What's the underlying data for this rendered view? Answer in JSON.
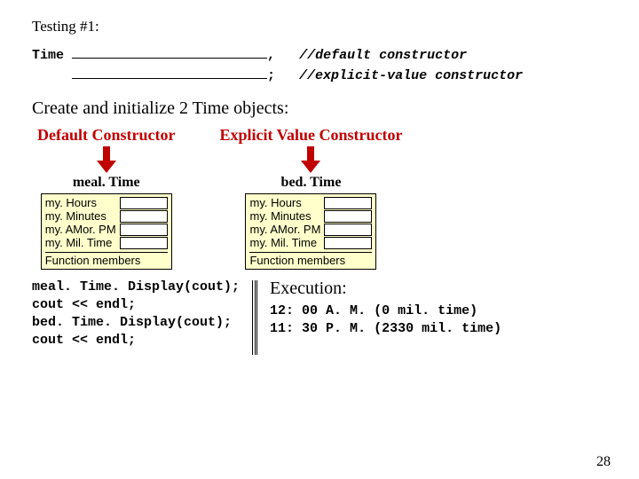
{
  "testing_label": "Testing #1:",
  "decl": {
    "type_kw": "Time",
    "comma": ",",
    "semicolon": ";",
    "comment1": "//default constructor",
    "comment2": "//explicit-value constructor"
  },
  "subhead": "Create and initialize 2 Time objects:",
  "ctor_default_title": "Default Constructor",
  "ctor_explicit_title": "Explicit Value Constructor",
  "obj1_label": "meal. Time",
  "obj2_label": "bed. Time",
  "members": [
    "my. Hours",
    "my. Minutes",
    "my. AMor. PM",
    "my. Mil. Time"
  ],
  "fn_members_label": "Function members",
  "left_code_lines": [
    "meal. Time. Display(cout);",
    "cout << endl;",
    "bed. Time. Display(cout);",
    "cout << endl;"
  ],
  "exec_title": "Execution:",
  "exec_output": [
    "12: 00 A. M. (0 mil. time)",
    "11: 30 P. M. (2330 mil. time)"
  ],
  "page_num": "28"
}
